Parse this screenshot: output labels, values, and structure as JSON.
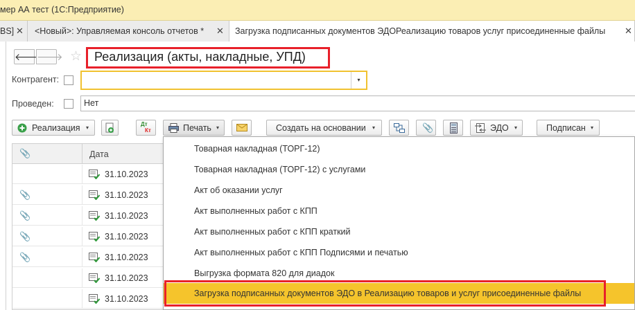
{
  "window": {
    "title": "мер АА тест  (1С:Предприятие)"
  },
  "tabs": [
    {
      "label": "BS]"
    },
    {
      "label": "<Новый>: Управляемая консоль отчетов *"
    },
    {
      "label": "Загрузка подписанных документов ЭДОРеализацию товаров услуг присоединенные файлы"
    }
  ],
  "tab_close": "✕",
  "nav": {
    "back": "🡐",
    "forward": "🡒"
  },
  "form": {
    "title": "Реализация (акты, накладные, УПД)"
  },
  "filters": {
    "kontragent_label": "Контрагент:",
    "kontragent_value": "",
    "provedeno_label": "Проведен:",
    "provedeno_value": "Нет"
  },
  "toolbar": {
    "realizaciya": "Реализация",
    "dtkt_top": "Дт",
    "dtkt_bottom": "Кт",
    "print": "Печать",
    "create_based": "Создать на основании",
    "edo": "ЭДО",
    "signed": "Подписан"
  },
  "table": {
    "col_date": "Дата",
    "rows": [
      {
        "date": "31.10.2023",
        "attachment": false
      },
      {
        "date": "31.10.2023",
        "attachment": true
      },
      {
        "date": "31.10.2023",
        "attachment": true
      },
      {
        "date": "31.10.2023",
        "attachment": true
      },
      {
        "date": "31.10.2023",
        "attachment": true
      },
      {
        "date": "31.10.2023",
        "attachment": false
      },
      {
        "date": "31.10.2023",
        "attachment": false
      }
    ]
  },
  "print_menu": {
    "items": [
      "Товарная накладная (ТОРГ-12)",
      "Товарная накладная (ТОРГ-12) с услугами",
      "Акт об оказании услуг",
      "Акт выполненных работ с КПП",
      "Акт выполненных работ с КПП краткий",
      "Акт выполненных работ с КПП Подписями и печатью",
      "Выгрузка формата 820 для диадок",
      "Загрузка подписанных документов ЭДО в Реализацию товаров и услуг присоединенные файлы"
    ],
    "highlighted_index": 7
  },
  "colors": {
    "accent_yellow": "#f5c42c",
    "annotation_red": "#e8202a",
    "titlebar": "#fbeeb4"
  }
}
